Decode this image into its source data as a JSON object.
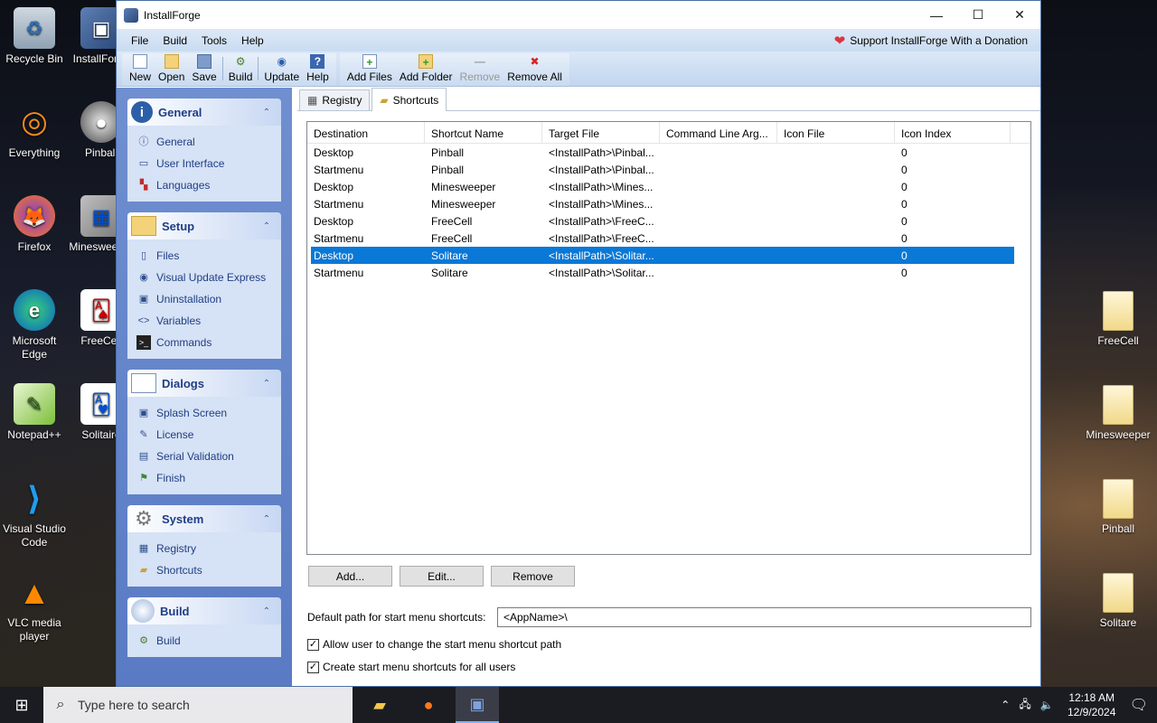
{
  "desktop": {
    "left_icons": [
      {
        "label": "Recycle Bin"
      },
      {
        "label": "InstallForge"
      },
      {
        "label": "Everything"
      },
      {
        "label": "Pinball"
      },
      {
        "label": "Firefox"
      },
      {
        "label": "Minesweeper"
      },
      {
        "label": "Microsoft Edge"
      },
      {
        "label": "FreeCell"
      },
      {
        "label": "Notepad++"
      },
      {
        "label": "Solitaire"
      },
      {
        "label": "Visual Studio Code"
      },
      {
        "label": "VLC media player"
      }
    ],
    "right_icons": [
      {
        "label": "FreeCell"
      },
      {
        "label": "Minesweeper"
      },
      {
        "label": "Pinball"
      },
      {
        "label": "Solitare"
      }
    ]
  },
  "window": {
    "title": "InstallForge",
    "controls": {
      "minimize": "—",
      "maximize": "☐",
      "close": "✕"
    }
  },
  "menu": {
    "items": [
      "File",
      "Build",
      "Tools",
      "Help"
    ],
    "donate": "Support InstallForge With a Donation"
  },
  "toolbar": {
    "new": "New",
    "open": "Open",
    "save": "Save",
    "build": "Build",
    "update": "Update",
    "help": "Help",
    "add_files": "Add Files",
    "add_folder": "Add Folder",
    "remove": "Remove",
    "remove_all": "Remove All"
  },
  "sidebar": {
    "groups": [
      {
        "title": "General",
        "items": [
          "General",
          "User Interface",
          "Languages"
        ]
      },
      {
        "title": "Setup",
        "items": [
          "Files",
          "Visual Update Express",
          "Uninstallation",
          "Variables",
          "Commands"
        ]
      },
      {
        "title": "Dialogs",
        "items": [
          "Splash Screen",
          "License",
          "Serial Validation",
          "Finish"
        ]
      },
      {
        "title": "System",
        "items": [
          "Registry",
          "Shortcuts"
        ]
      },
      {
        "title": "Build",
        "items": [
          "Build"
        ]
      }
    ]
  },
  "tabs": {
    "registry": "Registry",
    "shortcuts": "Shortcuts"
  },
  "table": {
    "columns": [
      "Destination",
      "Shortcut Name",
      "Target File",
      "Command Line Arg...",
      "Icon File",
      "Icon Index"
    ],
    "rows": [
      [
        "Desktop",
        "Pinball",
        "<InstallPath>\\Pinbal...",
        "",
        "",
        "0"
      ],
      [
        "Startmenu",
        "Pinball",
        "<InstallPath>\\Pinbal...",
        "",
        "",
        "0"
      ],
      [
        "Desktop",
        "Minesweeper",
        "<InstallPath>\\Mines...",
        "",
        "",
        "0"
      ],
      [
        "Startmenu",
        "Minesweeper",
        "<InstallPath>\\Mines...",
        "",
        "",
        "0"
      ],
      [
        "Desktop",
        "FreeCell",
        "<InstallPath>\\FreeC...",
        "",
        "",
        "0"
      ],
      [
        "Startmenu",
        "FreeCell",
        "<InstallPath>\\FreeC...",
        "",
        "",
        "0"
      ],
      [
        "Desktop",
        "Solitare",
        "<InstallPath>\\Solitar...",
        "",
        "",
        "0"
      ],
      [
        "Startmenu",
        "Solitare",
        "<InstallPath>\\Solitar...",
        "",
        "",
        "0"
      ]
    ],
    "selected_index": 6
  },
  "buttons": {
    "add": "Add...",
    "edit": "Edit...",
    "remove": "Remove"
  },
  "start_menu_path": {
    "label": "Default path for start menu shortcuts:",
    "value": "<AppName>\\"
  },
  "checkboxes": [
    {
      "label": "Allow user to change the start menu shortcut path",
      "checked": true
    },
    {
      "label": "Create start menu shortcuts for all users",
      "checked": true
    }
  ],
  "taskbar": {
    "search_placeholder": "Type here to search",
    "time": "12:18 AM",
    "date": "12/9/2024"
  },
  "colors": {
    "selection": "#0a78d7",
    "sidebar_bg": "#6f8fd0",
    "group_header_text": "#1f3e84"
  }
}
